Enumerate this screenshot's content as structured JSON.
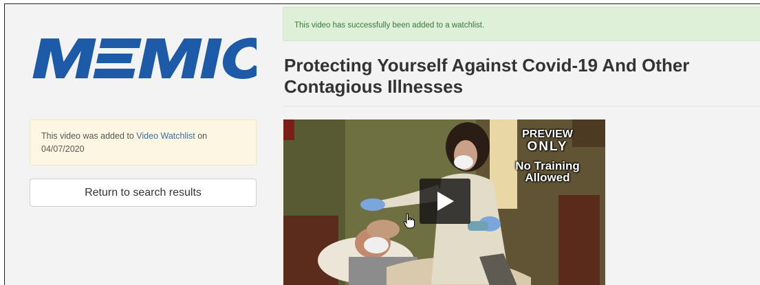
{
  "logo": {
    "text": "MEMIC",
    "color": "#1d5ba8"
  },
  "notice": {
    "prefix": "This video was added to ",
    "link": "Video Watchlist",
    "suffix": " on",
    "date": "04/07/2020"
  },
  "return_button": {
    "label": "Return to search results"
  },
  "success_alert": {
    "text": "This video has successfully been added to a watchlist."
  },
  "video": {
    "title": "Protecting Yourself Against Covid-19 And Other Contagious Illnesses",
    "overlay": {
      "line1": "PREVIEW",
      "line2": "ONLY",
      "line3": "No Training",
      "line4": "Allowed"
    },
    "play_icon": "play-icon"
  },
  "colors": {
    "success_bg": "#dff0d8",
    "success_text": "#3c763d",
    "notice_bg": "#fcf6e3",
    "link": "#3a6fa7",
    "logo_blue": "#1d5ba8"
  }
}
